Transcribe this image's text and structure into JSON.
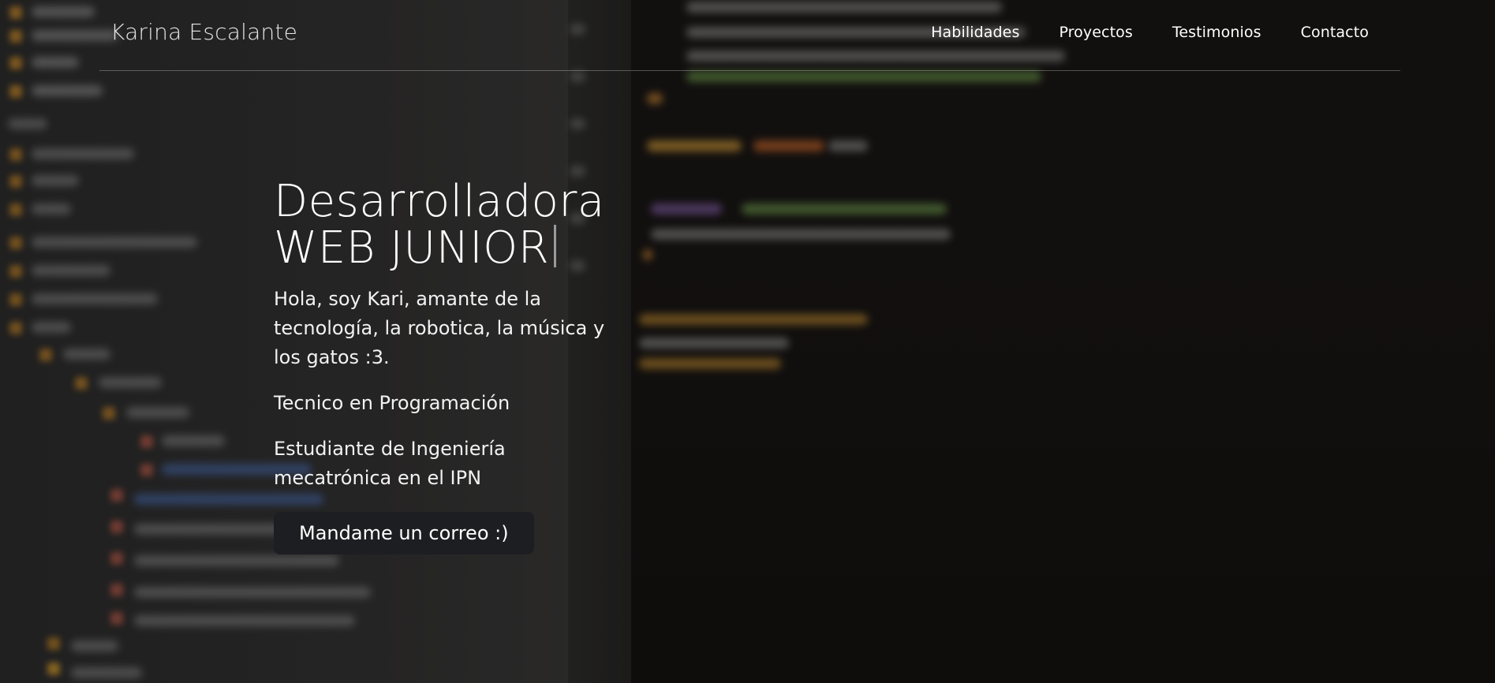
{
  "header": {
    "brand": "Karina Escalante",
    "nav": [
      "Habilidades",
      "Proyectos",
      "Testimonios",
      "Contacto"
    ]
  },
  "hero": {
    "title_line1": "Desarrolladora",
    "title_line2": "WEB JUNIOR",
    "intro": "Hola, soy Kari, amante de la tecnología, la robotica, la música y los gatos :3.",
    "career": "Tecnico en Programación",
    "study": "Estudiante de Ingeniería mecatrónica en el IPN",
    "cta_label": "Mandame un correo :)"
  },
  "colors": {
    "background": "#161413",
    "text": "#ffffff",
    "button": "#1d1e22"
  }
}
